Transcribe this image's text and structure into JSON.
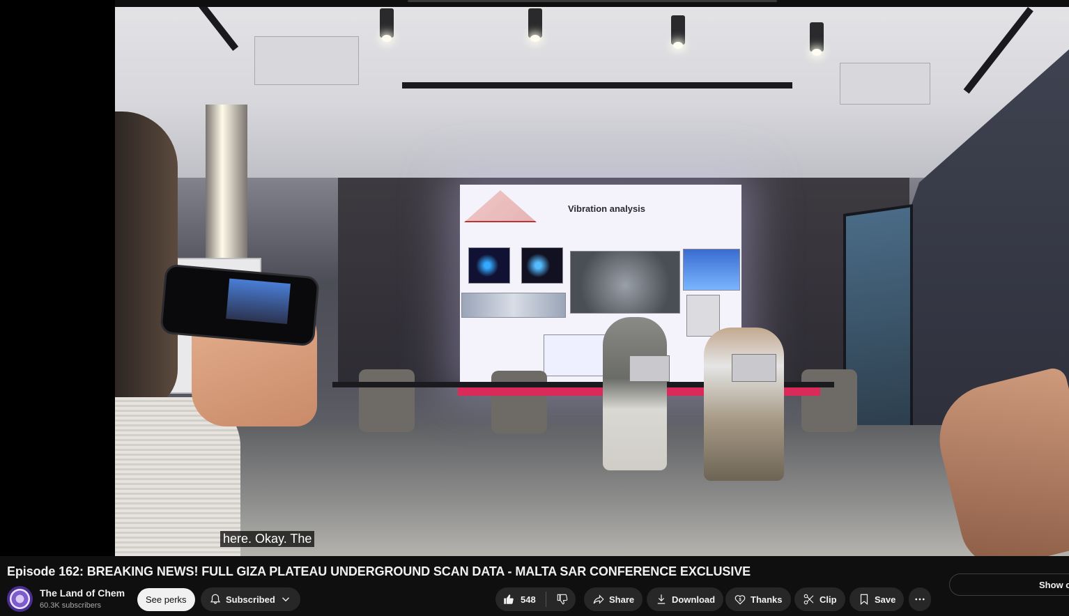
{
  "video": {
    "caption": "here. Okay. The",
    "slide_title": "Vibration analysis"
  },
  "info": {
    "title": "Episode 162: BREAKING NEWS! FULL GIZA PLATEAU UNDERGROUND SCAN DATA - MALTA SAR CONFERENCE EXCLUSIVE",
    "channel_name": "The Land of Chem",
    "subscribers": "60.3K subscribers",
    "see_perks": "See perks",
    "subscribed": "Subscribed",
    "like_count": "548",
    "share": "Share",
    "download": "Download",
    "thanks": "Thanks",
    "clip": "Clip",
    "save": "Save",
    "show_chat": "Show cl"
  },
  "icons": {
    "bell": "bell-icon",
    "chevron": "chevron-down-icon",
    "like": "thumbs-up-icon",
    "dislike": "thumbs-down-icon",
    "share": "share-icon",
    "download": "download-icon",
    "thanks": "thanks-icon",
    "clip": "scissors-icon",
    "save": "bookmark-icon",
    "more": "more-horizontal-icon"
  }
}
